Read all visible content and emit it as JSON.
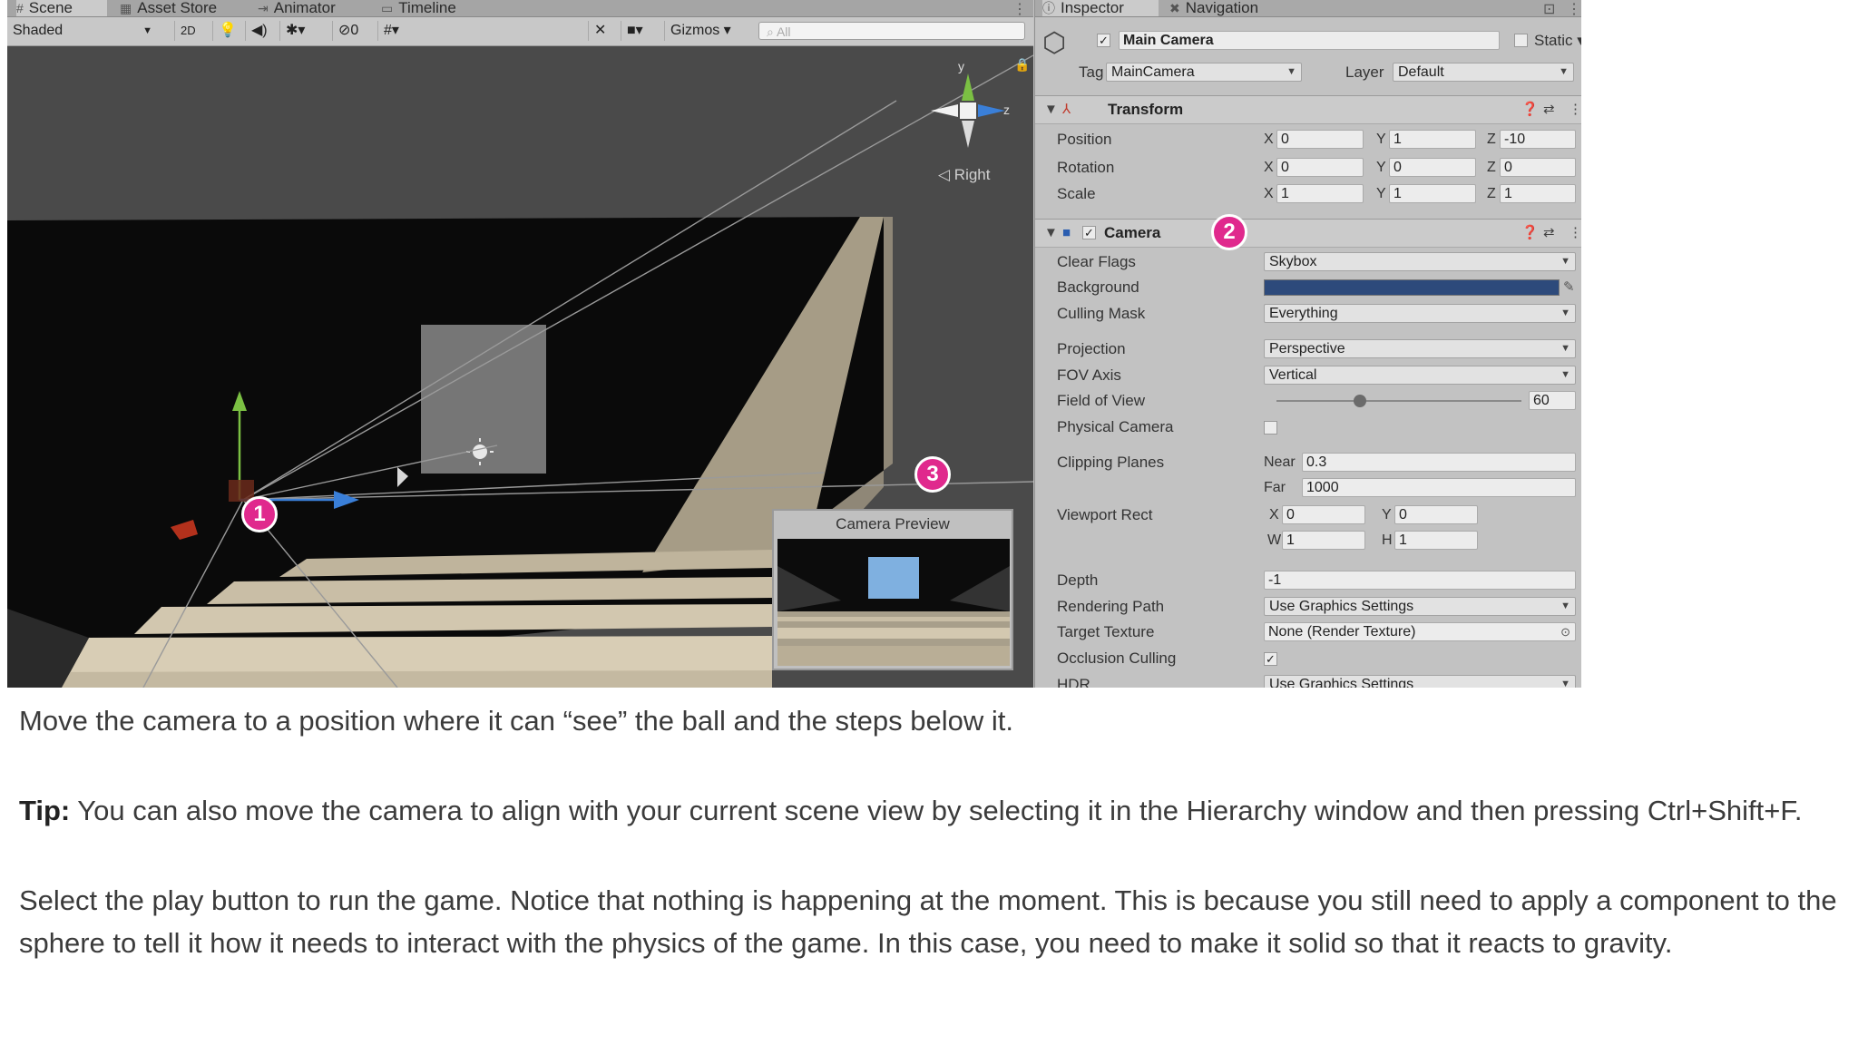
{
  "scene": {
    "tabs": [
      {
        "label": "Scene",
        "icon": "scene-icon"
      },
      {
        "label": "Asset Store",
        "icon": "store-icon"
      },
      {
        "label": "Animator",
        "icon": "animator-icon"
      },
      {
        "label": "Timeline",
        "icon": "timeline-icon"
      }
    ],
    "toolbar": {
      "shading_mode": "Shaded",
      "mode_2d": "2D",
      "hidden_count": "0",
      "gizmos_label": "Gizmos",
      "search_placeholder": "All"
    },
    "orientation_label": "Right",
    "gizmo_axes": {
      "y": "y",
      "z": "z"
    },
    "camera_preview_title": "Camera Preview",
    "badges": [
      "1",
      "2",
      "3"
    ]
  },
  "inspector": {
    "tabs": [
      {
        "label": "Inspector",
        "icon": "info-icon"
      },
      {
        "label": "Navigation",
        "icon": "navigation-icon"
      }
    ],
    "object": {
      "name": "Main Camera",
      "active": true,
      "static_label": "Static",
      "tag_label": "Tag",
      "tag_value": "MainCamera",
      "layer_label": "Layer",
      "layer_value": "Default"
    },
    "transform": {
      "title": "Transform",
      "rows": [
        {
          "label": "Position",
          "x": "0",
          "y": "1",
          "z": "-10"
        },
        {
          "label": "Rotation",
          "x": "0",
          "y": "0",
          "z": "0"
        },
        {
          "label": "Scale",
          "x": "1",
          "y": "1",
          "z": "1"
        }
      ]
    },
    "camera": {
      "title": "Camera",
      "clear_flags": {
        "label": "Clear Flags",
        "value": "Skybox"
      },
      "background": {
        "label": "Background",
        "color": "#2d4a7b"
      },
      "culling_mask": {
        "label": "Culling Mask",
        "value": "Everything"
      },
      "projection": {
        "label": "Projection",
        "value": "Perspective"
      },
      "fov_axis": {
        "label": "FOV Axis",
        "value": "Vertical"
      },
      "field_of_view": {
        "label": "Field of View",
        "value": "60",
        "slider_fraction": 0.34
      },
      "physical_camera": {
        "label": "Physical Camera",
        "checked": false
      },
      "clipping_planes": {
        "label": "Clipping Planes",
        "near_label": "Near",
        "near": "0.3",
        "far_label": "Far",
        "far": "1000"
      },
      "viewport_rect": {
        "label": "Viewport Rect",
        "x": "0",
        "y": "0",
        "w": "1",
        "h": "1"
      },
      "depth": {
        "label": "Depth",
        "value": "-1"
      },
      "rendering_path": {
        "label": "Rendering Path",
        "value": "Use Graphics Settings"
      },
      "target_texture": {
        "label": "Target Texture",
        "value": "None (Render Texture)"
      },
      "occlusion_culling": {
        "label": "Occlusion Culling",
        "checked": true
      },
      "hdr": {
        "label": "HDR",
        "value": "Use Graphics Settings"
      }
    },
    "axis_labels": {
      "x": "X",
      "y": "Y",
      "z": "Z",
      "w": "W",
      "h": "H"
    }
  },
  "article": {
    "p1": "Move the camera to a position where it can “see” the ball and the steps below it.",
    "tip_label": "Tip:",
    "tip_text": " You can also move the camera to align with your current scene view by selecting it in the Hierarchy window and then pressing Ctrl+Shift+F.",
    "p3": "Select the play button to run the game. Notice that nothing is happening at the moment. This is because you still need to apply a component to the sphere to tell it how it needs to interact with the physics of the game. In this case, you need to make it solid so that it reacts to gravity."
  }
}
